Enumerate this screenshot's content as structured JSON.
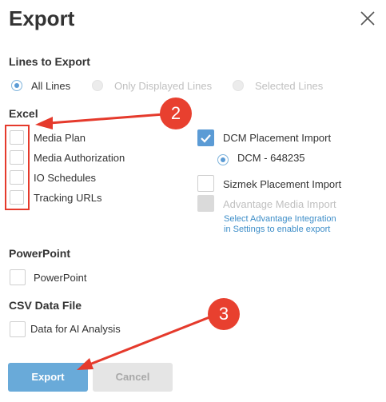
{
  "dialog": {
    "title": "Export"
  },
  "lines_to_export": {
    "heading": "Lines to Export",
    "options": [
      {
        "label": "All Lines",
        "selected": true,
        "enabled": true
      },
      {
        "label": "Only Displayed Lines",
        "selected": false,
        "enabled": false
      },
      {
        "label": "Selected Lines",
        "selected": false,
        "enabled": false
      }
    ]
  },
  "excel": {
    "heading": "Excel",
    "left_items": [
      {
        "label": "Media Plan",
        "checked": false
      },
      {
        "label": "Media Authorization",
        "checked": false
      },
      {
        "label": "IO Schedules",
        "checked": false
      },
      {
        "label": "Tracking URLs",
        "checked": false
      }
    ],
    "dcm_placement": {
      "label": "DCM Placement Import",
      "checked": true
    },
    "dcm_account": {
      "label": "DCM - 648235",
      "selected": true
    },
    "sizmek_placement": {
      "label": "Sizmek Placement Import",
      "checked": false
    },
    "advantage_media": {
      "label": "Advantage Media Import",
      "checked": false,
      "enabled": false
    },
    "advantage_link": {
      "line1": "Select Advantage Integration",
      "line2": "in Settings to enable export"
    }
  },
  "powerpoint": {
    "heading": "PowerPoint",
    "item": {
      "label": "PowerPoint",
      "checked": false
    }
  },
  "csv": {
    "heading": "CSV Data File",
    "item": {
      "label": "Data for AI Analysis",
      "checked": false
    }
  },
  "buttons": {
    "export": "Export",
    "cancel": "Cancel"
  },
  "annotations": {
    "badge_2": "2",
    "badge_3": "3"
  },
  "colors": {
    "accent": "#5b9bd5",
    "annotation_red": "#e53a2c",
    "export_button": "#69aad9"
  }
}
